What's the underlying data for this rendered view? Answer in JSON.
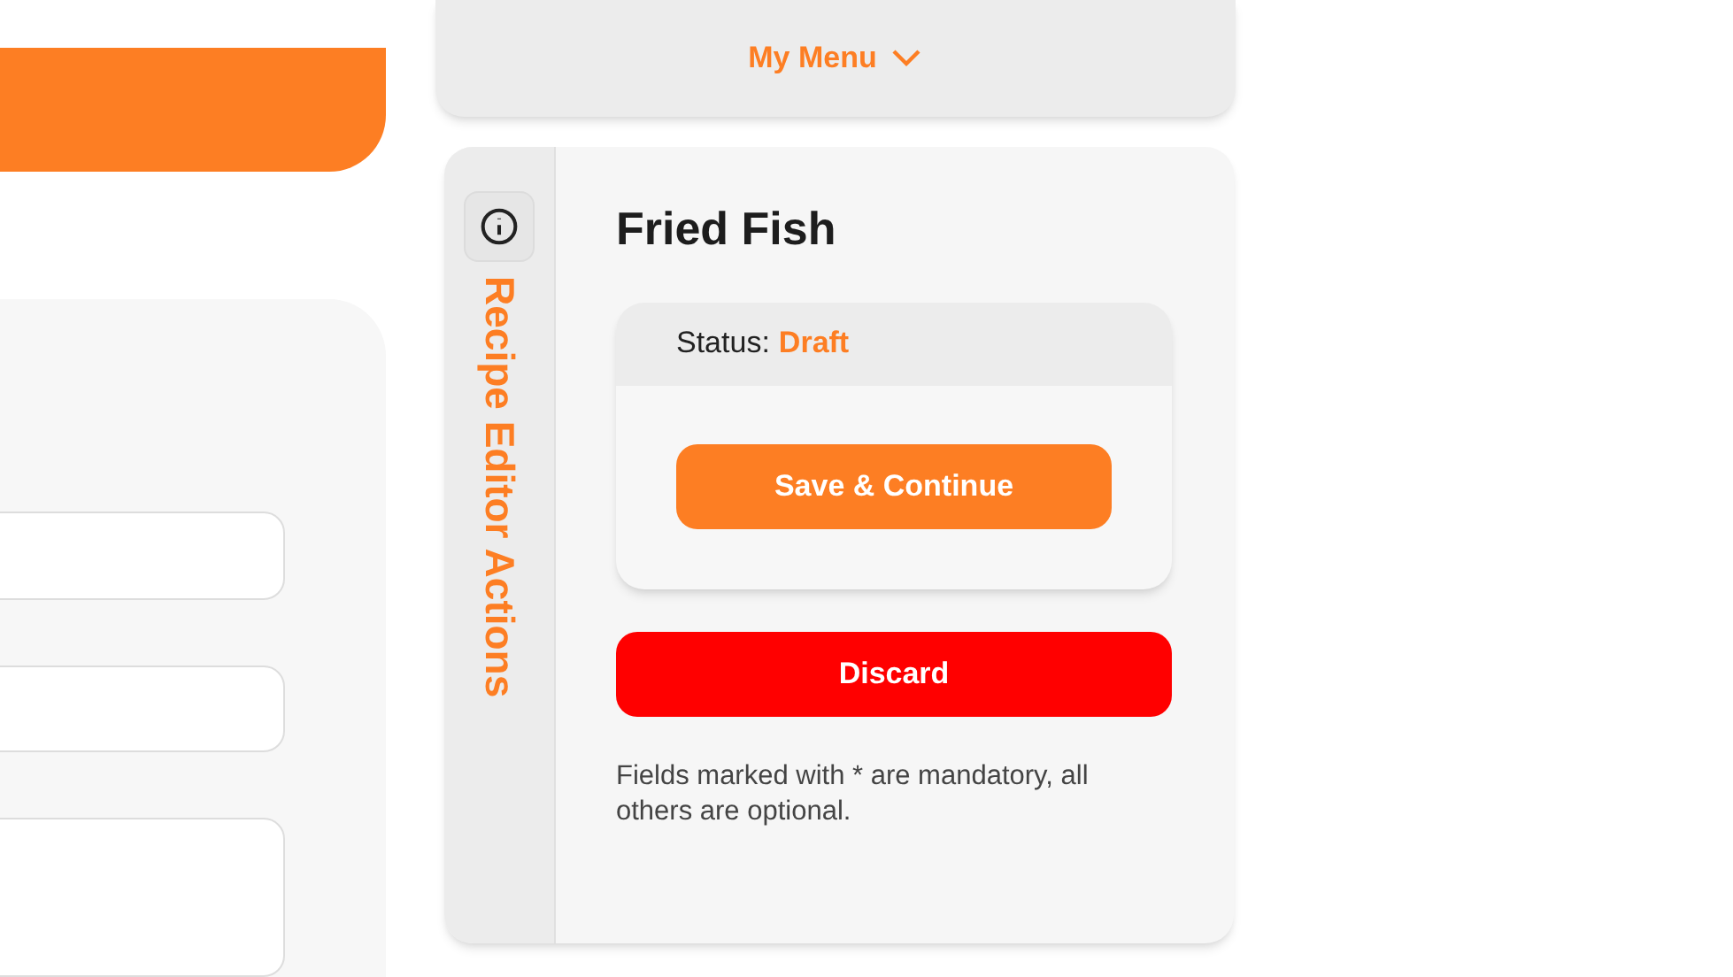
{
  "menu": {
    "label": "My Menu"
  },
  "sidebar": {
    "title": "Recipe Editor Actions"
  },
  "recipe": {
    "title": "Fried Fish"
  },
  "status_card": {
    "label": "Status:",
    "value": "Draft",
    "button": "Save & Continue"
  },
  "discard_button": "Discard",
  "note": "Fields marked with * are mandatory, all others are optional."
}
